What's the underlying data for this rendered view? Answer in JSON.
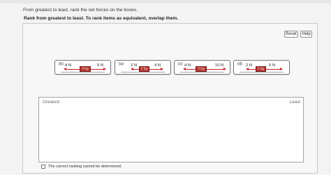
{
  "instruction": "From greatest to least, rank the net forces on the boxes.",
  "subinstruction": "Rank from greatest to least. To rank items as equivalent, overlap them.",
  "buttons": {
    "reset": "Reset",
    "help": "Help"
  },
  "cards": [
    {
      "letter": "(b)",
      "left_force": "4 N",
      "mass": "4 kg",
      "right_force": "9 N"
    },
    {
      "letter": "(a)",
      "left_force": "2 N",
      "mass": "2 kg",
      "right_force": "4 N"
    },
    {
      "letter": "(c)",
      "left_force": "4 N",
      "mass": "2 kg",
      "right_force": "10 N"
    },
    {
      "letter": "(d)",
      "left_force": "2 N",
      "mass": "2 kg",
      "right_force": "5 N"
    }
  ],
  "ranking": {
    "greatest_label": "Greatest",
    "least_label": "Least"
  },
  "checkbox_label": "The correct ranking cannot be determined.",
  "colors": {
    "arrow": "#c8202a",
    "box": "#b5332e",
    "background": "#f3f3f4"
  }
}
